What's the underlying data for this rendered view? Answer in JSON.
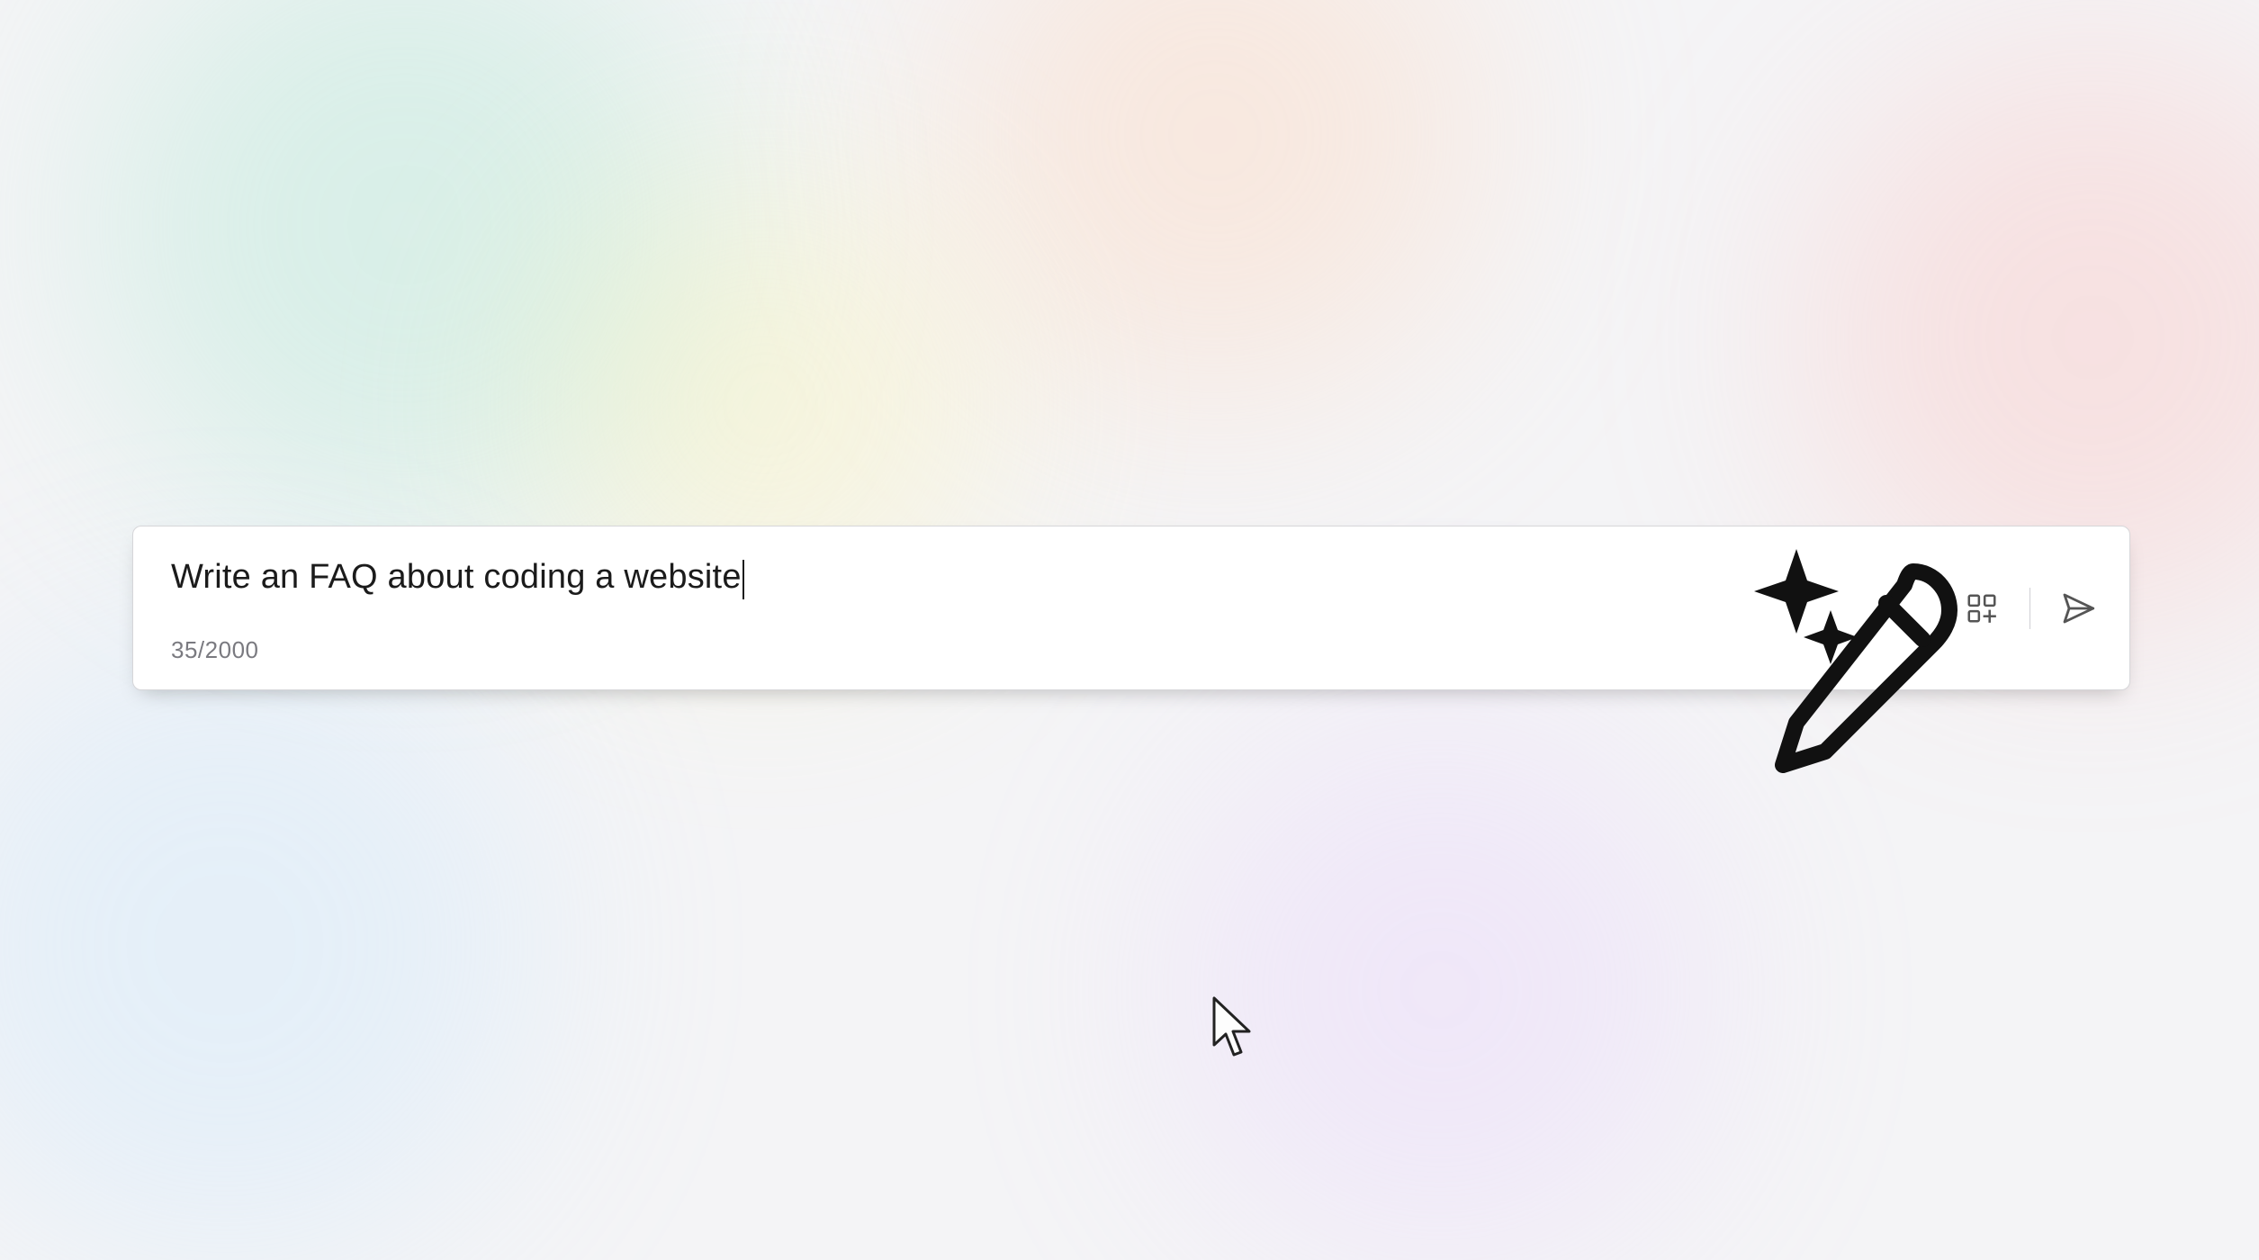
{
  "prompt": {
    "value": "Write an FAQ about coding a website",
    "char_count_display": "35/2000",
    "char_count": 35,
    "char_limit": 2000
  },
  "actions": {
    "apps_icon_name": "apps-grid-icon",
    "send_icon_name": "send-icon"
  },
  "overlay": {
    "illustration_name": "sparkle-pen-icon"
  }
}
